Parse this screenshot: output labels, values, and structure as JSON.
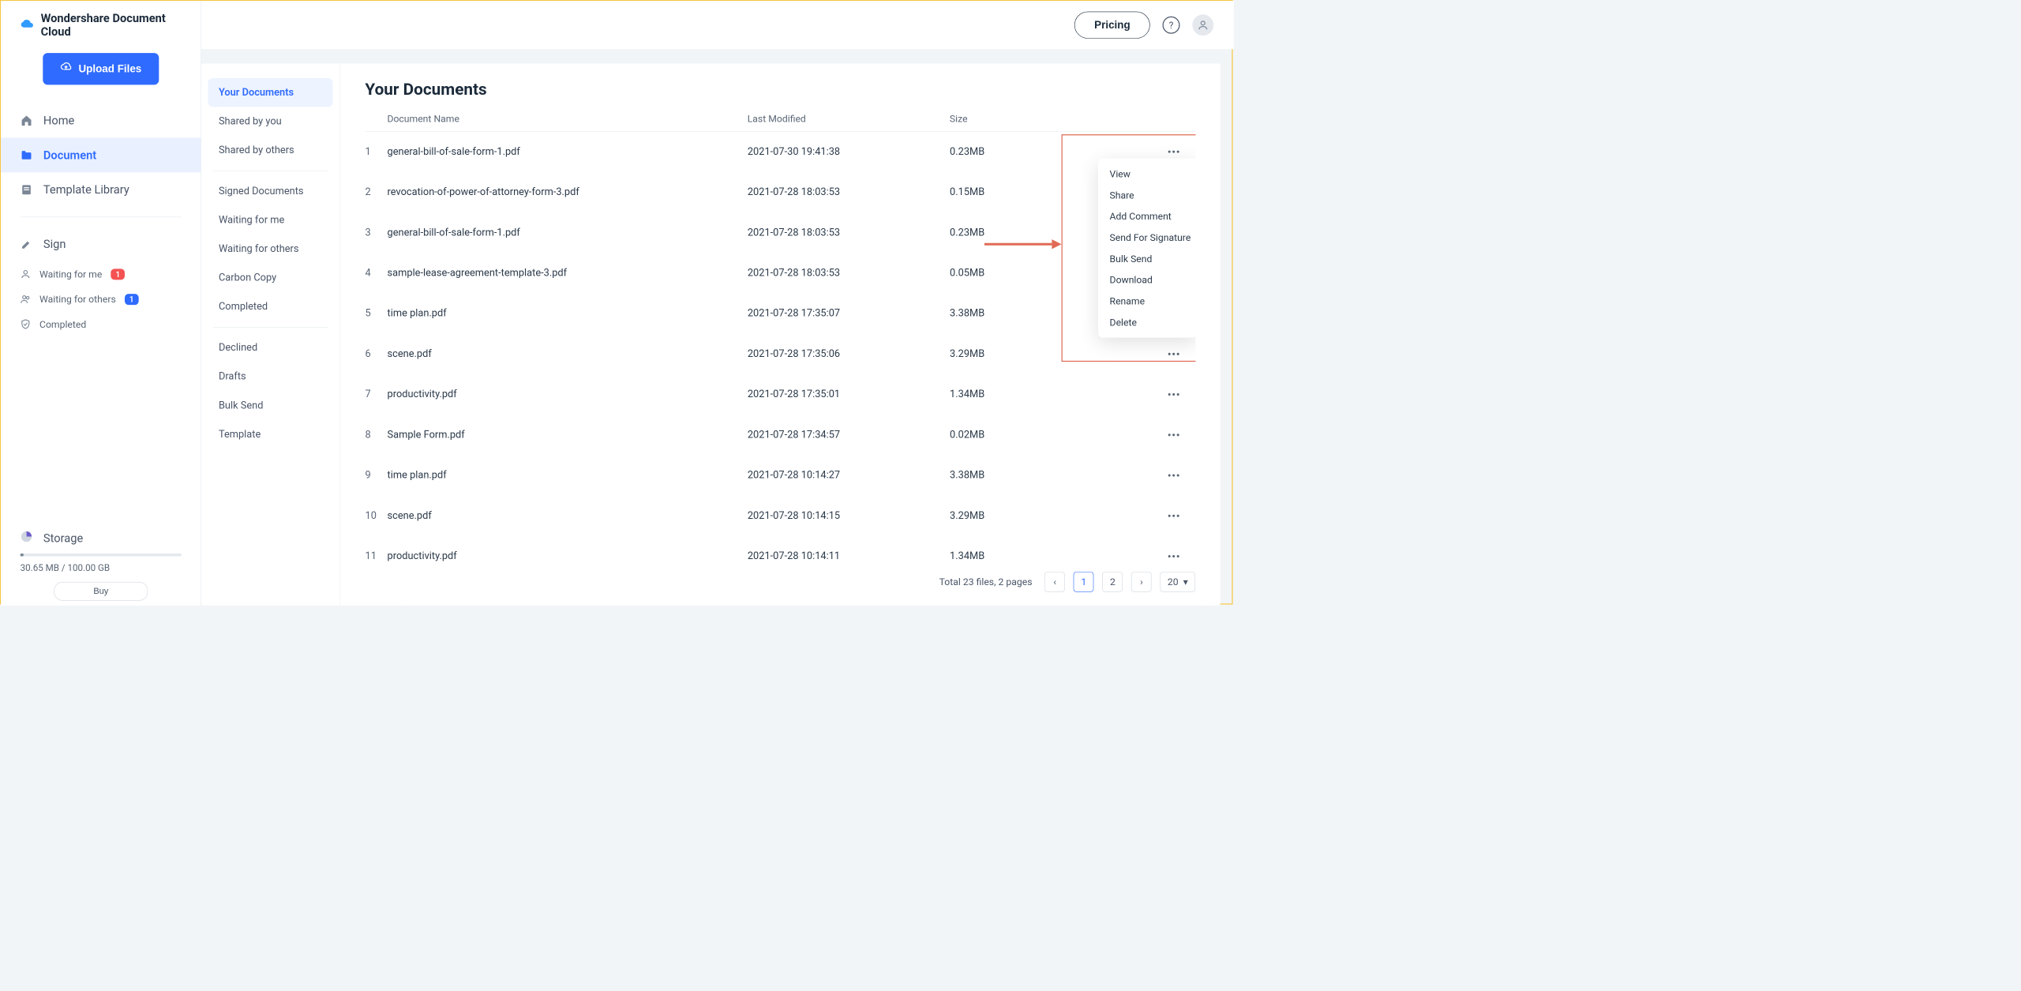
{
  "brand": "Wondershare Document Cloud",
  "upload_label": "Upload Files",
  "side_nav": {
    "home": "Home",
    "document": "Document",
    "templates": "Template Library",
    "sign": "Sign",
    "waiting_me": "Waiting for me",
    "waiting_me_badge": "1",
    "waiting_others": "Waiting for others",
    "waiting_others_badge": "1",
    "completed": "Completed",
    "storage": "Storage",
    "storage_usage": "30.65 MB / 100.00 GB",
    "buy": "Buy"
  },
  "topbar": {
    "pricing": "Pricing"
  },
  "sub_sidebar": [
    "Your Documents",
    "Shared by you",
    "Shared by others",
    "Signed Documents",
    "Waiting for me",
    "Waiting for others",
    "Carbon Copy",
    "Completed",
    "Declined",
    "Drafts",
    "Bulk Send",
    "Template"
  ],
  "page_title": "Your Documents",
  "columns": {
    "name": "Document Name",
    "modified": "Last Modified",
    "size": "Size"
  },
  "rows": [
    {
      "n": "1",
      "name": "general-bill-of-sale-form-1.pdf",
      "modified": "2021-07-30 19:41:38",
      "size": "0.23MB"
    },
    {
      "n": "2",
      "name": "revocation-of-power-of-attorney-form-3.pdf",
      "modified": "2021-07-28 18:03:53",
      "size": "0.15MB"
    },
    {
      "n": "3",
      "name": "general-bill-of-sale-form-1.pdf",
      "modified": "2021-07-28 18:03:53",
      "size": "0.23MB"
    },
    {
      "n": "4",
      "name": "sample-lease-agreement-template-3.pdf",
      "modified": "2021-07-28 18:03:53",
      "size": "0.05MB"
    },
    {
      "n": "5",
      "name": "time plan.pdf",
      "modified": "2021-07-28 17:35:07",
      "size": "3.38MB"
    },
    {
      "n": "6",
      "name": "scene.pdf",
      "modified": "2021-07-28 17:35:06",
      "size": "3.29MB"
    },
    {
      "n": "7",
      "name": "productivity.pdf",
      "modified": "2021-07-28 17:35:01",
      "size": "1.34MB"
    },
    {
      "n": "8",
      "name": "Sample Form.pdf",
      "modified": "2021-07-28 17:34:57",
      "size": "0.02MB"
    },
    {
      "n": "9",
      "name": "time plan.pdf",
      "modified": "2021-07-28 10:14:27",
      "size": "3.38MB"
    },
    {
      "n": "10",
      "name": "scene.pdf",
      "modified": "2021-07-28 10:14:15",
      "size": "3.29MB"
    },
    {
      "n": "11",
      "name": "productivity.pdf",
      "modified": "2021-07-28 10:14:11",
      "size": "1.34MB"
    }
  ],
  "context_menu": [
    "View",
    "Share",
    "Add Comment",
    "Send For Signature",
    "Bulk Send",
    "Download",
    "Rename",
    "Delete"
  ],
  "pagination": {
    "summary": "Total 23 files, 2 pages",
    "pages": [
      "1",
      "2"
    ],
    "page_size": "20"
  }
}
